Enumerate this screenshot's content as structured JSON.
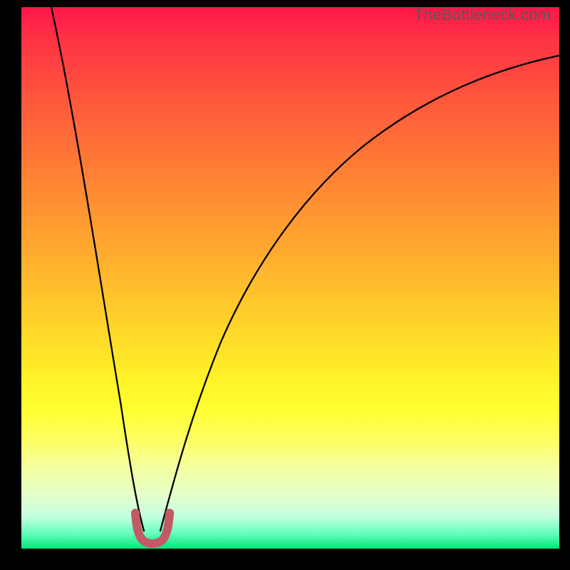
{
  "attribution": "TheBottleneck.com",
  "chart_data": {
    "type": "line",
    "title": "",
    "xlabel": "",
    "ylabel": "",
    "xlim": [
      0,
      100
    ],
    "ylim": [
      0,
      100
    ],
    "grid": false,
    "series": [
      {
        "name": "bottleneck-curve",
        "x": [
          5,
          8,
          11,
          14,
          17,
          19,
          20.5,
          22,
          23.5,
          25,
          26.5,
          28,
          31,
          35,
          40,
          46,
          52,
          58,
          65,
          73,
          82,
          92,
          100
        ],
        "y": [
          100,
          84,
          68,
          52,
          36,
          20,
          10,
          3,
          0,
          0,
          3,
          10,
          22,
          35,
          47,
          57,
          64,
          70,
          75,
          79,
          82,
          84,
          85
        ],
        "color": "#000000"
      }
    ],
    "annotations": [
      {
        "name": "optimal-region-marker",
        "shape": "u",
        "x_center": 24,
        "width": 6,
        "color": "#c15a64"
      }
    ],
    "background_gradient": {
      "type": "vertical",
      "stops": [
        {
          "pos": 0.0,
          "color": "#ff154a"
        },
        {
          "pos": 0.5,
          "color": "#ffcf2a"
        },
        {
          "pos": 0.8,
          "color": "#ffff40"
        },
        {
          "pos": 1.0,
          "color": "#00e87a"
        }
      ]
    }
  }
}
